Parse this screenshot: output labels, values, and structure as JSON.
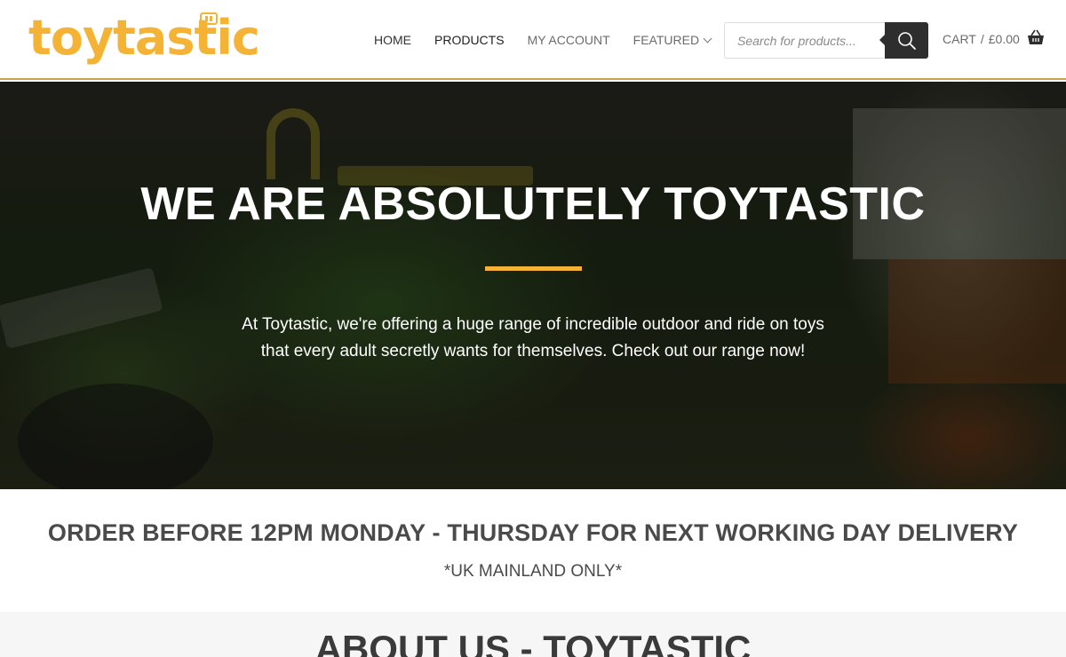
{
  "header": {
    "logo_text": "toytastic",
    "nav": [
      {
        "label": "HOME"
      },
      {
        "label": "PRODUCTS"
      },
      {
        "label": "MY ACCOUNT"
      },
      {
        "label": "FEATURED"
      }
    ],
    "search": {
      "placeholder": "Search for products..."
    },
    "cart": {
      "label": "CART",
      "separator": "/",
      "amount": "£0.00"
    }
  },
  "hero": {
    "title": "WE ARE ABSOLUTELY TOYTASTIC",
    "text": "At Toytastic, we're offering a huge range of incredible outdoor and ride on toys that every adult secretly wants for themselves. Check out our range now!"
  },
  "notice": {
    "main": "ORDER BEFORE 12PM MONDAY - THURSDAY FOR NEXT WORKING DAY DELIVERY",
    "sub": "*UK MAINLAND ONLY*"
  },
  "about": {
    "title": "ABOUT US - TOYTASTIC"
  },
  "colors": {
    "brand": "#f5b335",
    "dark": "#2e2e2e"
  },
  "icons": {
    "search": "search-icon",
    "cart": "basket-icon",
    "chevron": "chevron-down-icon"
  }
}
